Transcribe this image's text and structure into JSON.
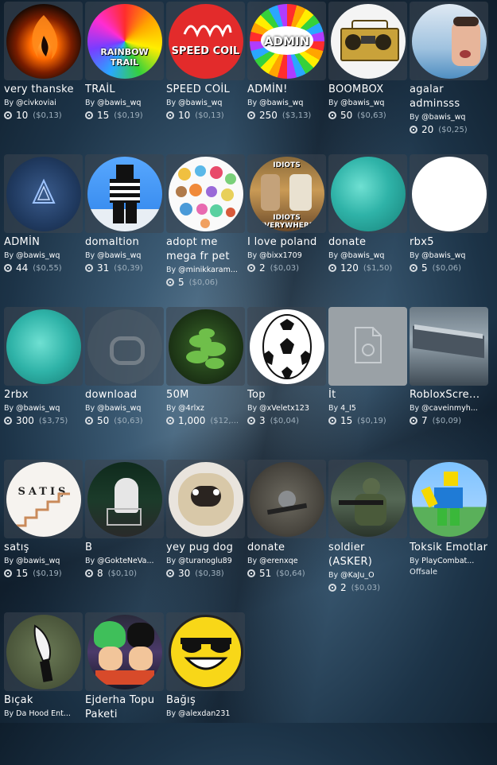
{
  "items": [
    {
      "name": "very thanske",
      "creator": "@civkoviai",
      "price": "10",
      "usd": "($0,13)"
    },
    {
      "name": "TRAİL",
      "creator": "@bawis_wq",
      "price": "15",
      "usd": "($0,19)"
    },
    {
      "name": "SPEED COİL",
      "creator": "@bawis_wq",
      "price": "10",
      "usd": "($0,13)"
    },
    {
      "name": "ADMİN!",
      "creator": "@bawis_wq",
      "price": "250",
      "usd": "($3,13)"
    },
    {
      "name": "BOOMBOX",
      "creator": "@bawis_wq",
      "price": "50",
      "usd": "($0,63)"
    },
    {
      "name": "agalar adminsss",
      "creator": "@bawis_wq",
      "price": "20",
      "usd": "($0,25)"
    },
    {
      "name": "ADMİN",
      "creator": "@bawis_wq",
      "price": "44",
      "usd": "($0,55)"
    },
    {
      "name": "domaltion",
      "creator": "@bawis_wq",
      "price": "31",
      "usd": "($0,39)"
    },
    {
      "name": "adopt me mega fr pet",
      "creator": "@minikkaram...",
      "price": "5",
      "usd": "($0,06)"
    },
    {
      "name": "I love poland",
      "creator": "@bixx1709",
      "price": "2",
      "usd": "($0,03)"
    },
    {
      "name": "donate",
      "creator": "@bawis_wq",
      "price": "120",
      "usd": "($1,50)"
    },
    {
      "name": "rbx5",
      "creator": "@bawis_wq",
      "price": "5",
      "usd": "($0,06)"
    },
    {
      "name": "2rbx",
      "creator": "@bawis_wq",
      "price": "300",
      "usd": "($3,75)"
    },
    {
      "name": "download",
      "creator": "@bawis_wq",
      "price": "50",
      "usd": "($0,63)"
    },
    {
      "name": "50M",
      "creator": "@4rlxz",
      "price": "1,000",
      "usd": "($12,..."
    },
    {
      "name": "Top",
      "creator": "@xVeletx123",
      "price": "3",
      "usd": "($0,04)"
    },
    {
      "name": "İt",
      "creator": "4_I5",
      "price": "15",
      "usd": "($0,19)"
    },
    {
      "name": "RobloxScre...",
      "creator": "@caveinmyh...",
      "price": "7",
      "usd": "($0,09)"
    },
    {
      "name": "satış",
      "creator": "@bawis_wq",
      "price": "15",
      "usd": "($0,19)"
    },
    {
      "name": "B",
      "creator": "@GokteNeVa...",
      "price": "8",
      "usd": "($0,10)"
    },
    {
      "name": "yey pug dog",
      "creator": "@turanoglu89",
      "price": "30",
      "usd": "($0,38)"
    },
    {
      "name": "donate",
      "creator": "@erenxqe",
      "price": "51",
      "usd": "($0,64)"
    },
    {
      "name": "soldier (ASKER)",
      "creator": "@KaJu_O",
      "price": "2",
      "usd": "($0,03)"
    },
    {
      "name": "Toksik Emotlar",
      "creator": "PlayCombat...",
      "offsale": "Offsale"
    },
    {
      "name": "Bıçak",
      "creator": "Da Hood Ent..."
    },
    {
      "name": "Ejderha Topu Paketi",
      "creator": ""
    },
    {
      "name": "Bağış",
      "creator": "@alexdan231"
    }
  ],
  "by_label": "By",
  "thumb_texts": {
    "rainbow_trail": "RAINBOW TRAIL",
    "speed_coil": "SPEED COIL",
    "admin": "ADMIN",
    "idiots_top": "IDIOTS",
    "idiots_bottom": "IDIOTS EVERYWHERE",
    "satis": "SATIŞ"
  },
  "colors": {
    "accent_rainbow": "#ff3b3b",
    "coil_red": "#e32b2b",
    "sea": "#2fb3a8"
  }
}
